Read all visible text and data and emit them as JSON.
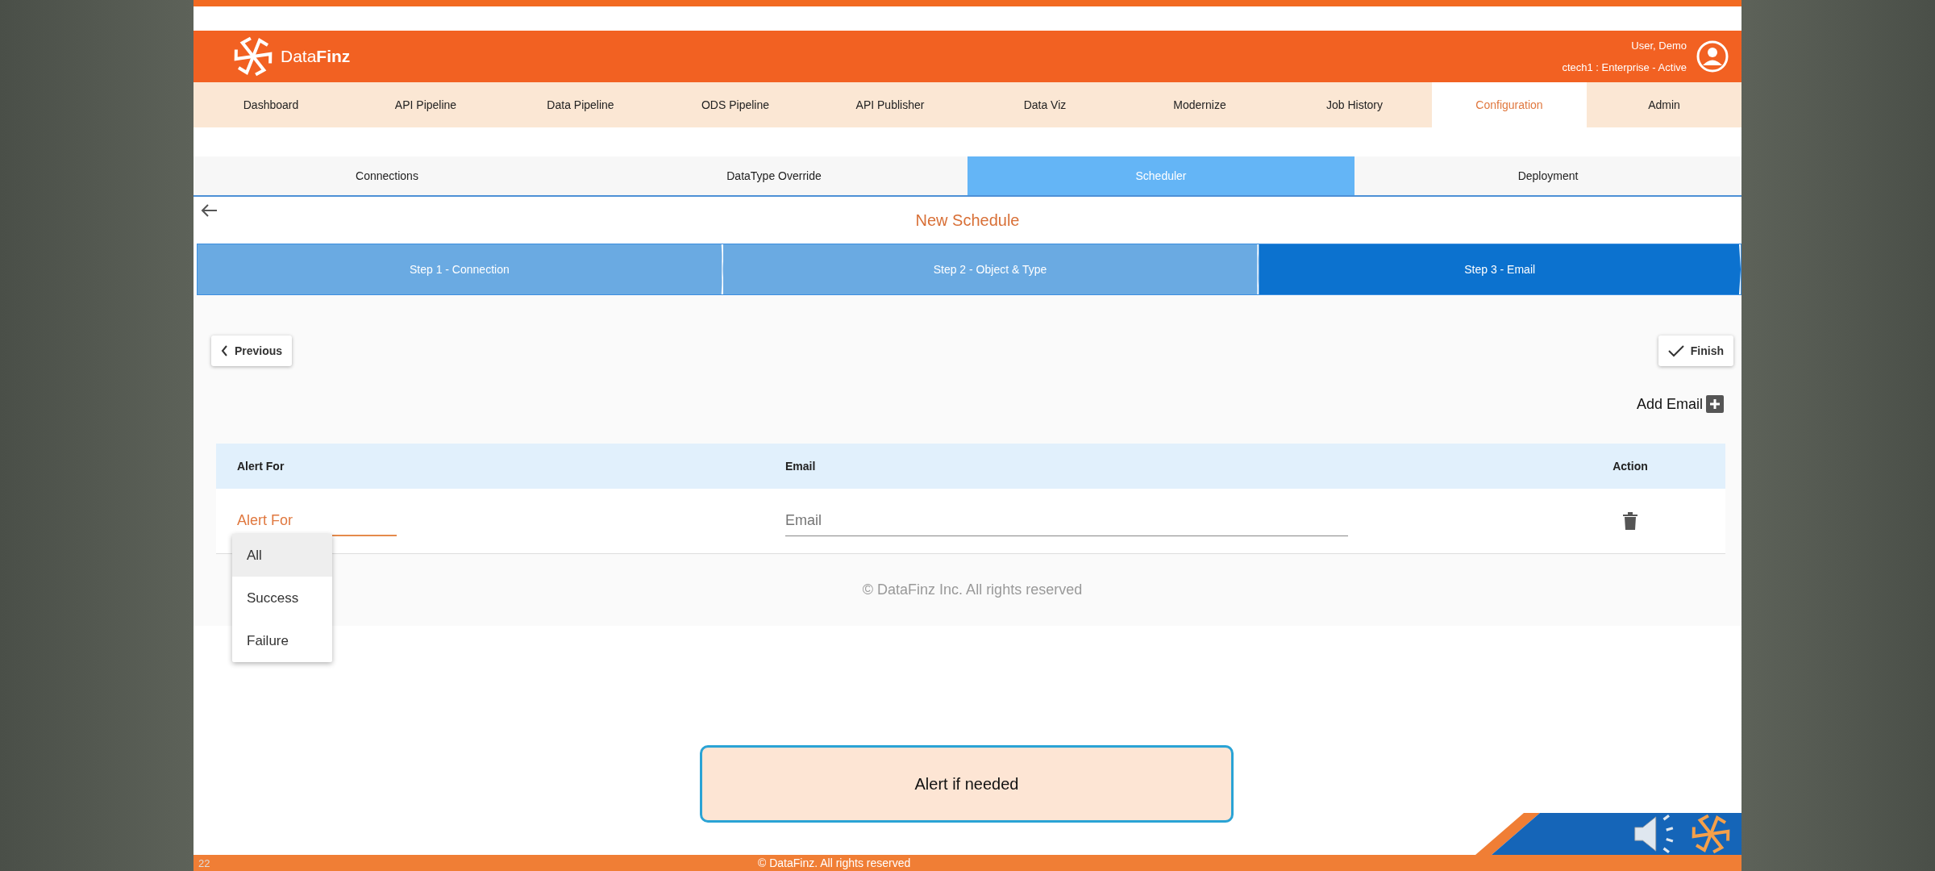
{
  "header": {
    "logo": "Data**Finz**",
    "user": "User, Demo",
    "account": "ctech1 : Enterprise - Active"
  },
  "nav": [
    {
      "label": "Dashboard",
      "selected": false
    },
    {
      "label": "API Pipeline",
      "selected": false
    },
    {
      "label": "Data Pipeline",
      "selected": false
    },
    {
      "label": "ODS Pipeline",
      "selected": false
    },
    {
      "label": "API Publisher",
      "selected": false
    },
    {
      "label": "Data Viz",
      "selected": false
    },
    {
      "label": "Modernize",
      "selected": false
    },
    {
      "label": "Job History",
      "selected": false
    },
    {
      "label": "Configuration",
      "selected": true
    },
    {
      "label": "Admin",
      "selected": false
    }
  ],
  "subtabs": [
    {
      "label": "Connections",
      "selected": false
    },
    {
      "label": "DataType Override",
      "selected": false
    },
    {
      "label": "Scheduler",
      "selected": true
    },
    {
      "label": "Deployment",
      "selected": false
    }
  ],
  "page_title": "New Schedule",
  "steps": [
    {
      "label": "Step 1 - Connection",
      "selected": false
    },
    {
      "label": "Step 2 - Object & Type",
      "selected": false
    },
    {
      "label": "Step 3 - Email",
      "selected": true
    }
  ],
  "buttons": {
    "previous": "Previous",
    "finish": "Finish",
    "add_email": "Add Email"
  },
  "table": {
    "columns": [
      "Alert For",
      "Email",
      "Action"
    ],
    "row": {
      "alert_for": {
        "placeholder": "Alert For",
        "focused": true
      },
      "email": {
        "placeholder": "Email"
      }
    }
  },
  "dropdown": [
    {
      "label": "All",
      "selected": true
    },
    {
      "label": "Success",
      "selected": false
    },
    {
      "label": "Failure",
      "selected": false
    }
  ],
  "footer": "© DataFinz Inc. All rights reserved",
  "callout": "Alert if needed",
  "slide_footer": {
    "page": "22",
    "copyright": "© DataFinz. All rights reserved"
  }
}
